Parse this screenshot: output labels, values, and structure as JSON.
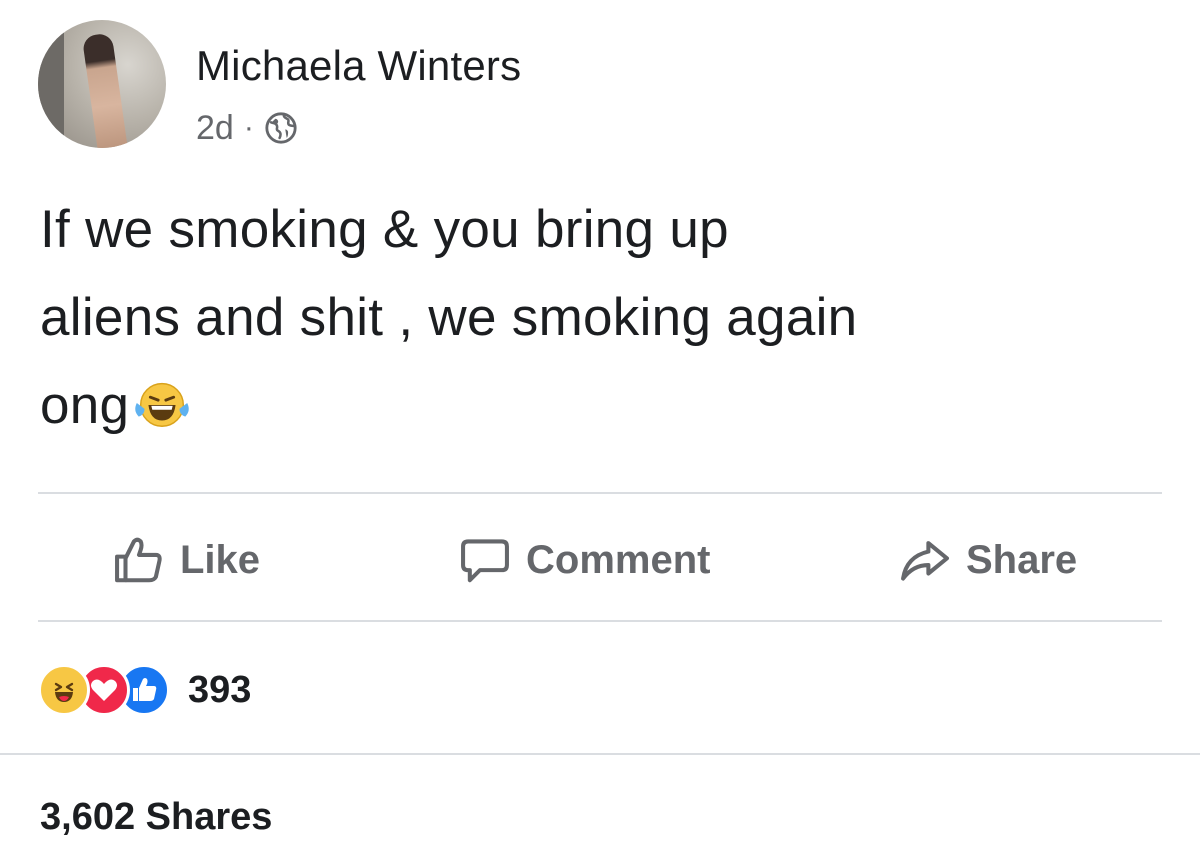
{
  "post": {
    "author": "Michaela Winters",
    "timestamp": "2d",
    "separator": "·",
    "privacy_icon": "globe-icon",
    "text_lines": [
      "If we smoking & you bring up",
      "aliens and shit , we smoking again",
      "ong"
    ],
    "inline_emoji": "laughing-crying-emoji"
  },
  "actions": {
    "like_label": "Like",
    "comment_label": "Comment",
    "share_label": "Share"
  },
  "reactions": {
    "types": [
      "haha",
      "love",
      "like"
    ],
    "count": "393"
  },
  "shares": {
    "label": "3,602 Shares"
  },
  "colors": {
    "text_primary": "#1c1e21",
    "text_secondary": "#65676b",
    "divider": "#dadde1",
    "like_blue": "#1877f2",
    "love_red": "#f0284a",
    "haha_yellow": "#f7c744"
  }
}
